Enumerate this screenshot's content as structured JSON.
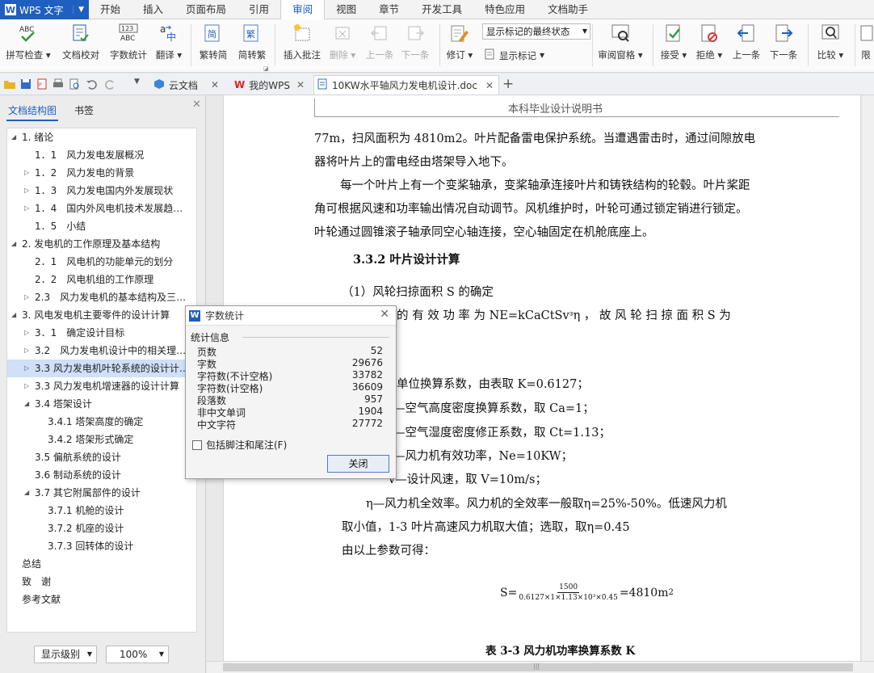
{
  "app": {
    "name": "WPS 文字"
  },
  "menu_tabs": [
    "开始",
    "插入",
    "页面布局",
    "引用",
    "审阅",
    "视图",
    "章节",
    "开发工具",
    "特色应用",
    "文档助手"
  ],
  "active_menu_tab": "审阅",
  "ribbon": {
    "spell_check": "拼写检查",
    "doc_proofread": "文档校对",
    "word_count": "字数统计",
    "translate": "翻译",
    "trad_to_simp": "繁转简",
    "simp_to_trad": "简转繁",
    "insert_comment": "插入批注",
    "delete": "删除",
    "prev": "上一条",
    "next": "下一条",
    "track_changes": "修订",
    "display_markup_select": "显示标记的最终状态",
    "show_markup": "显示标记",
    "review_pane": "审阅窗格",
    "accept": "接受",
    "reject": "拒绝",
    "prev2": "上一条",
    "next2": "下一条",
    "compare": "比较",
    "restrict": "限"
  },
  "doc_tabs": {
    "cloud": "云文档",
    "mywps": "我的WPS",
    "active_doc": "10KW水平轴风力发电机设计.doc"
  },
  "left_pane": {
    "tab_structure": "文档结构图",
    "tab_bookmark": "书签",
    "tree": [
      {
        "label": "1.  绪论",
        "level": 0,
        "toggle": "◢"
      },
      {
        "label": "1．1　风力发电发展概况",
        "level": 1,
        "toggle": ""
      },
      {
        "label": "1．2　风力发电的背景",
        "level": 1,
        "toggle": "▷"
      },
      {
        "label": "1．3　风力发电国内外发展现状",
        "level": 1,
        "toggle": "▷"
      },
      {
        "label": "1．4　国内外风电机技术发展趋…",
        "level": 1,
        "toggle": "▷"
      },
      {
        "label": "1．5　小结",
        "level": 1,
        "toggle": ""
      },
      {
        "label": "2.  发电机的工作原理及基本结构",
        "level": 0,
        "toggle": "◢"
      },
      {
        "label": "2．1　风电机的功能单元的划分",
        "level": 1,
        "toggle": ""
      },
      {
        "label": "2．2　风电机组的工作原理",
        "level": 1,
        "toggle": ""
      },
      {
        "label": "2.3　风力发电机的基本结构及三…",
        "level": 1,
        "toggle": "▷"
      },
      {
        "label": "3.  风电发电机主要零件的设计计算",
        "level": 0,
        "toggle": "◢"
      },
      {
        "label": "3．1　确定设计目标",
        "level": 1,
        "toggle": "▷"
      },
      {
        "label": "3.2　风力发电机设计中的相关理…",
        "level": 1,
        "toggle": "▷"
      },
      {
        "label": "3.3 风力发电机叶轮系统的设计计…",
        "level": 1,
        "toggle": "▷",
        "selected": true
      },
      {
        "label": "3.3 风力发电机增速器的设计计算",
        "level": 1,
        "toggle": "▷"
      },
      {
        "label": "3.4 塔架设计",
        "level": 1,
        "toggle": "◢"
      },
      {
        "label": "3.4.1 塔架高度的确定",
        "level": 2,
        "toggle": ""
      },
      {
        "label": "3.4.2 塔架形式确定",
        "level": 2,
        "toggle": ""
      },
      {
        "label": "3.5 偏航系统的设计",
        "level": 1,
        "toggle": ""
      },
      {
        "label": "3.6 制动系统的设计",
        "level": 1,
        "toggle": ""
      },
      {
        "label": "3.7 其它附属部件的设计",
        "level": 1,
        "toggle": "◢"
      },
      {
        "label": "3.7.1 机舱的设计",
        "level": 2,
        "toggle": ""
      },
      {
        "label": "3.7.2 机座的设计",
        "level": 2,
        "toggle": ""
      },
      {
        "label": "3.7.3 回转体的设计",
        "level": 2,
        "toggle": ""
      },
      {
        "label": "总结",
        "level": -1,
        "toggle": ""
      },
      {
        "label": "致　谢",
        "level": -1,
        "toggle": ""
      },
      {
        "label": "参考文献",
        "level": -1,
        "toggle": ""
      }
    ],
    "display_level": "显示级别",
    "zoom": "100%"
  },
  "document": {
    "header": "本科毕业设计说明书",
    "lines": [
      "77m，扫风面积为 4810m2。叶片配备雷电保护系统。当遭遇雷击时，通过间隙放电",
      "器将叶片上的雷电经由塔架导入地下。",
      "每一个叶片上有一个变桨轴承，变桨轴承连接叶片和铸铁结构的轮毂。叶片桨距",
      "角可根据风速和功率输出情况自动调节。风机维护时，叶轮可通过锁定销进行锁定。",
      "叶轮通过圆锥滚子轴承同空心轴连接，空心轴固定在机舱底座上。",
      "3.3.2 叶片设计计算",
      "（1）风轮扫掠面积 S 的确定",
      "的  有  效  功  率  为    NE=kCaCtSvᶟη  ，  故  风  轮  扫  掠  面  积    S  为",
      "单位换算系数，由表取 K=0.6127；",
      "—空气高度密度换算系数，取 Ca=1；",
      "—空气湿度密度修正系数，取 Ct=1.13；",
      "—风力机有效功率，Ne=10KW；",
      "v—设计风速，取 V=10m/s；",
      "η—风力机全效率。风力机的全效率一般取η=25%-50%。低速风力机",
      "取小值，1-3 叶片高速风力机取大值；选取，取η=0.45",
      "由以上参数可得：",
      "表 3-3    风力机功率换算系数 K"
    ],
    "formula": {
      "lhs": "S=",
      "numerator": "1500",
      "denominator": "0.6127×1×1.13×10³×0.45",
      "rhs": "=4810m",
      "sup": "2"
    }
  },
  "dialog": {
    "title": "字数统计",
    "group": "统计信息",
    "stats": [
      {
        "label": "页数",
        "value": "52"
      },
      {
        "label": "字数",
        "value": "29676"
      },
      {
        "label": "字符数(不计空格)",
        "value": "33782"
      },
      {
        "label": "字符数(计空格)",
        "value": "36609"
      },
      {
        "label": "段落数",
        "value": "957"
      },
      {
        "label": "非中文单词",
        "value": "1904"
      },
      {
        "label": "中文字符",
        "value": "27772"
      }
    ],
    "include_footnotes": "包括脚注和尾注(F)",
    "close": "关闭"
  }
}
